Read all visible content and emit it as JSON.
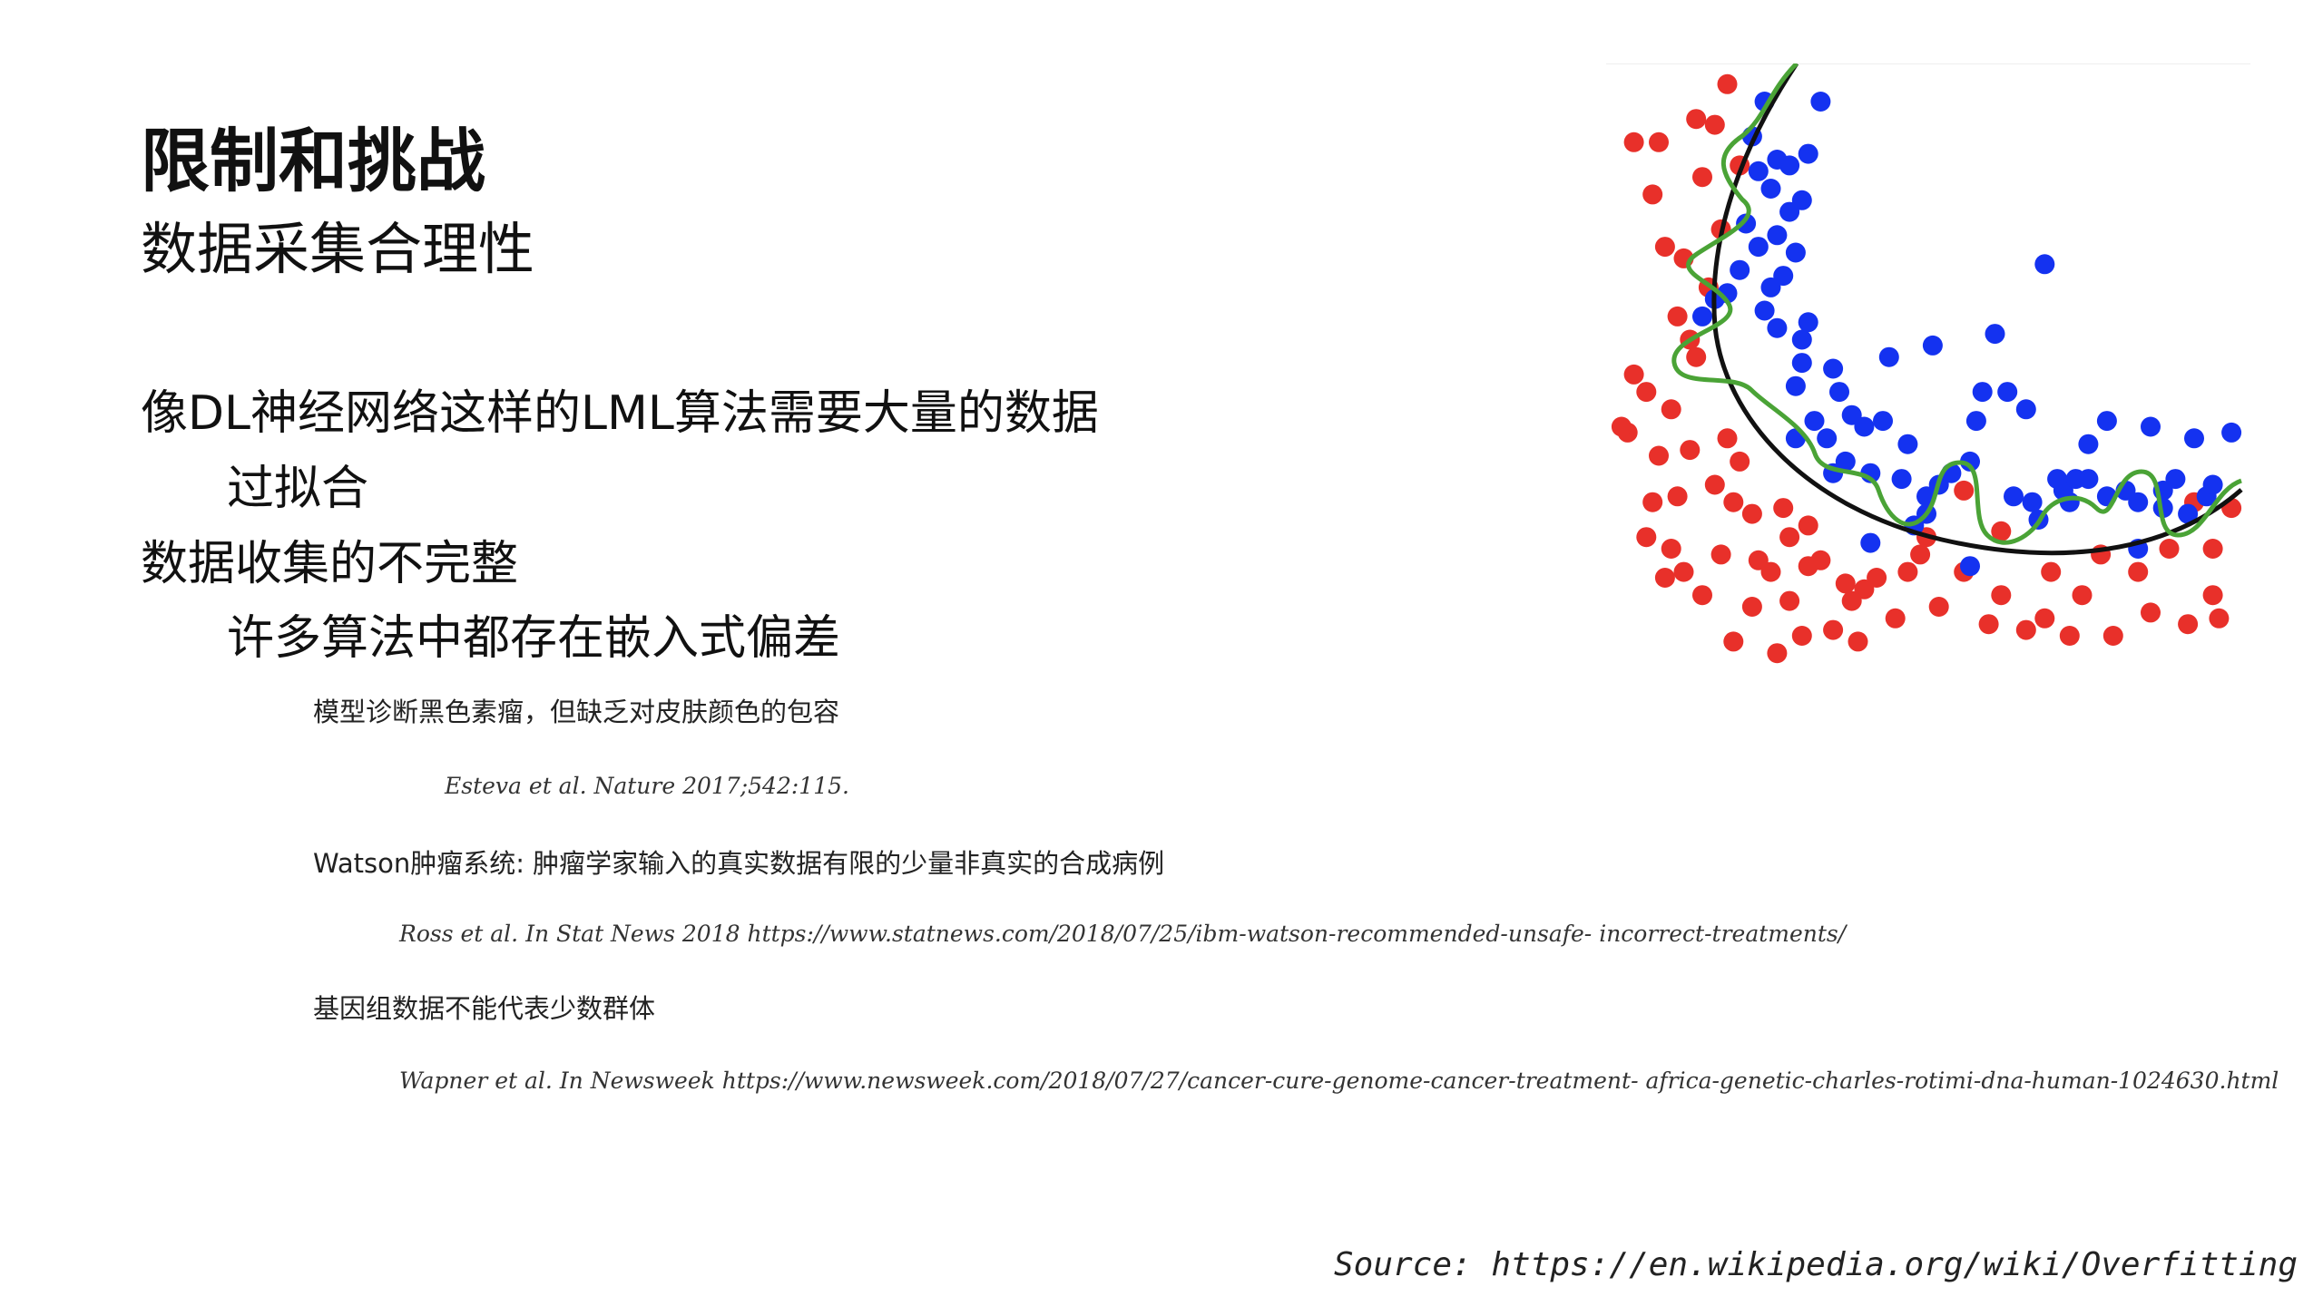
{
  "slide": {
    "title": "限制和挑战",
    "subtitle": "数据采集合理性",
    "bullets": {
      "b1": "像DL神经网络这样的LML算法需要大量的数据",
      "b1_sub": "过拟合",
      "b2": "数据收集的不完整",
      "b2_sub": "许多算法中都存在嵌入式偏差",
      "e1": "模型诊断黑色素瘤，但缺乏对皮肤颜色的包容",
      "e1_ref": "Esteva et al. Nature 2017;542:115.",
      "e2": "Watson肿瘤系统: 肿瘤学家输入的真实数据有限的少量非真实的合成病例",
      "e2_ref": "Ross et al. In Stat News 2018 https://www.statnews.com/2018/07/25/ibm-watson-recommended-unsafe- incorrect-treatments/",
      "e3": "基因组数据不能代表少数群体",
      "e3_ref": "Wapner et al. In Newsweek https://www.newsweek.com/2018/07/27/cancer-cure-genome-cancer-treatment- africa-genetic-charles-rotimi-dna-human-1024630.html"
    },
    "source": "Source: https://en.wikipedia.org/wiki/Overfitting"
  },
  "figure": {
    "colors": {
      "red": "#e8302a",
      "blue": "#1432f0",
      "black_curve": "#111111",
      "green_curve": "#4aa336",
      "frame_line": "#eeeeee"
    },
    "red_points": [
      [
        0.09,
        0.82
      ],
      [
        0.06,
        0.74
      ],
      [
        0.02,
        0.62
      ],
      [
        0.05,
        0.55
      ],
      [
        0.03,
        0.52
      ],
      [
        0.01,
        0.61
      ],
      [
        0.07,
        0.66
      ],
      [
        0.09,
        0.58
      ],
      [
        0.12,
        0.46
      ],
      [
        0.15,
        0.37
      ],
      [
        0.11,
        0.32
      ],
      [
        0.08,
        0.3
      ],
      [
        0.06,
        0.21
      ],
      [
        0.14,
        0.18
      ],
      [
        0.03,
        0.12
      ],
      [
        0.07,
        0.12
      ],
      [
        0.13,
        0.08
      ],
      [
        0.18,
        0.02
      ],
      [
        0.16,
        0.09
      ],
      [
        0.2,
        0.16
      ],
      [
        0.17,
        0.27
      ],
      [
        0.1,
        0.42
      ],
      [
        0.13,
        0.49
      ],
      [
        0.05,
        0.8
      ],
      [
        0.11,
        0.86
      ],
      [
        0.08,
        0.87
      ],
      [
        0.14,
        0.9
      ],
      [
        0.22,
        0.92
      ],
      [
        0.28,
        0.91
      ],
      [
        0.19,
        0.98
      ],
      [
        0.26,
        1.0
      ],
      [
        0.31,
        0.85
      ],
      [
        0.25,
        0.86
      ],
      [
        0.3,
        0.97
      ],
      [
        0.35,
        0.96
      ],
      [
        0.39,
        0.98
      ],
      [
        0.45,
        0.94
      ],
      [
        0.52,
        0.92
      ],
      [
        0.6,
        0.95
      ],
      [
        0.66,
        0.96
      ],
      [
        0.73,
        0.97
      ],
      [
        0.8,
        0.97
      ],
      [
        0.86,
        0.93
      ],
      [
        0.92,
        0.95
      ],
      [
        0.97,
        0.94
      ],
      [
        0.96,
        0.9
      ],
      [
        0.84,
        0.86
      ],
      [
        0.78,
        0.83
      ],
      [
        0.7,
        0.86
      ],
      [
        0.62,
        0.9
      ],
      [
        0.56,
        0.86
      ],
      [
        0.49,
        0.83
      ],
      [
        0.42,
        0.87
      ],
      [
        0.37,
        0.88
      ],
      [
        0.33,
        0.84
      ],
      [
        0.28,
        0.8
      ],
      [
        0.22,
        0.76
      ],
      [
        0.19,
        0.74
      ],
      [
        0.16,
        0.71
      ],
      [
        0.12,
        0.65
      ],
      [
        0.1,
        0.73
      ],
      [
        0.18,
        0.63
      ],
      [
        0.2,
        0.67
      ],
      [
        0.4,
        0.89
      ],
      [
        0.5,
        0.8
      ],
      [
        0.56,
        0.72
      ],
      [
        0.93,
        0.74
      ],
      [
        0.99,
        0.75
      ],
      [
        0.96,
        0.82
      ],
      [
        0.89,
        0.82
      ],
      [
        0.23,
        0.84
      ],
      [
        0.27,
        0.75
      ],
      [
        0.31,
        0.78
      ],
      [
        0.17,
        0.83
      ],
      [
        0.38,
        0.91
      ],
      [
        0.47,
        0.86
      ],
      [
        0.62,
        0.79
      ],
      [
        0.69,
        0.94
      ],
      [
        0.75,
        0.9
      ]
    ],
    "blue_points": [
      [
        0.24,
        0.05
      ],
      [
        0.26,
        0.15
      ],
      [
        0.28,
        0.16
      ],
      [
        0.23,
        0.17
      ],
      [
        0.25,
        0.2
      ],
      [
        0.28,
        0.24
      ],
      [
        0.29,
        0.31
      ],
      [
        0.27,
        0.35
      ],
      [
        0.25,
        0.37
      ],
      [
        0.2,
        0.34
      ],
      [
        0.16,
        0.39
      ],
      [
        0.14,
        0.42
      ],
      [
        0.24,
        0.41
      ],
      [
        0.26,
        0.44
      ],
      [
        0.3,
        0.46
      ],
      [
        0.3,
        0.5
      ],
      [
        0.29,
        0.54
      ],
      [
        0.35,
        0.51
      ],
      [
        0.36,
        0.55
      ],
      [
        0.38,
        0.59
      ],
      [
        0.32,
        0.6
      ],
      [
        0.29,
        0.63
      ],
      [
        0.34,
        0.63
      ],
      [
        0.4,
        0.61
      ],
      [
        0.37,
        0.67
      ],
      [
        0.43,
        0.6
      ],
      [
        0.47,
        0.64
      ],
      [
        0.41,
        0.69
      ],
      [
        0.46,
        0.7
      ],
      [
        0.5,
        0.73
      ],
      [
        0.48,
        0.78
      ],
      [
        0.52,
        0.71
      ],
      [
        0.54,
        0.69
      ],
      [
        0.57,
        0.67
      ],
      [
        0.58,
        0.6
      ],
      [
        0.59,
        0.55
      ],
      [
        0.66,
        0.58
      ],
      [
        0.67,
        0.74
      ],
      [
        0.68,
        0.77
      ],
      [
        0.72,
        0.72
      ],
      [
        0.73,
        0.74
      ],
      [
        0.76,
        0.7
      ],
      [
        0.76,
        0.64
      ],
      [
        0.79,
        0.6
      ],
      [
        0.82,
        0.72
      ],
      [
        0.84,
        0.74
      ],
      [
        0.88,
        0.72
      ],
      [
        0.9,
        0.7
      ],
      [
        0.92,
        0.76
      ],
      [
        0.95,
        0.73
      ],
      [
        0.96,
        0.71
      ],
      [
        0.99,
        0.62
      ],
      [
        0.93,
        0.63
      ],
      [
        0.86,
        0.61
      ],
      [
        0.84,
        0.82
      ],
      [
        0.74,
        0.7
      ],
      [
        0.63,
        0.55
      ],
      [
        0.61,
        0.45
      ],
      [
        0.69,
        0.33
      ],
      [
        0.51,
        0.47
      ],
      [
        0.44,
        0.49
      ],
      [
        0.22,
        0.11
      ],
      [
        0.31,
        0.14
      ],
      [
        0.3,
        0.22
      ],
      [
        0.33,
        0.05
      ],
      [
        0.5,
        0.76
      ],
      [
        0.57,
        0.85
      ],
      [
        0.64,
        0.73
      ],
      [
        0.41,
        0.81
      ],
      [
        0.35,
        0.69
      ],
      [
        0.21,
        0.26
      ],
      [
        0.23,
        0.3
      ],
      [
        0.26,
        0.28
      ],
      [
        0.18,
        0.38
      ],
      [
        0.31,
        0.43
      ],
      [
        0.88,
        0.75
      ],
      [
        0.79,
        0.73
      ],
      [
        0.71,
        0.7
      ]
    ],
    "marker_radius": 11
  }
}
